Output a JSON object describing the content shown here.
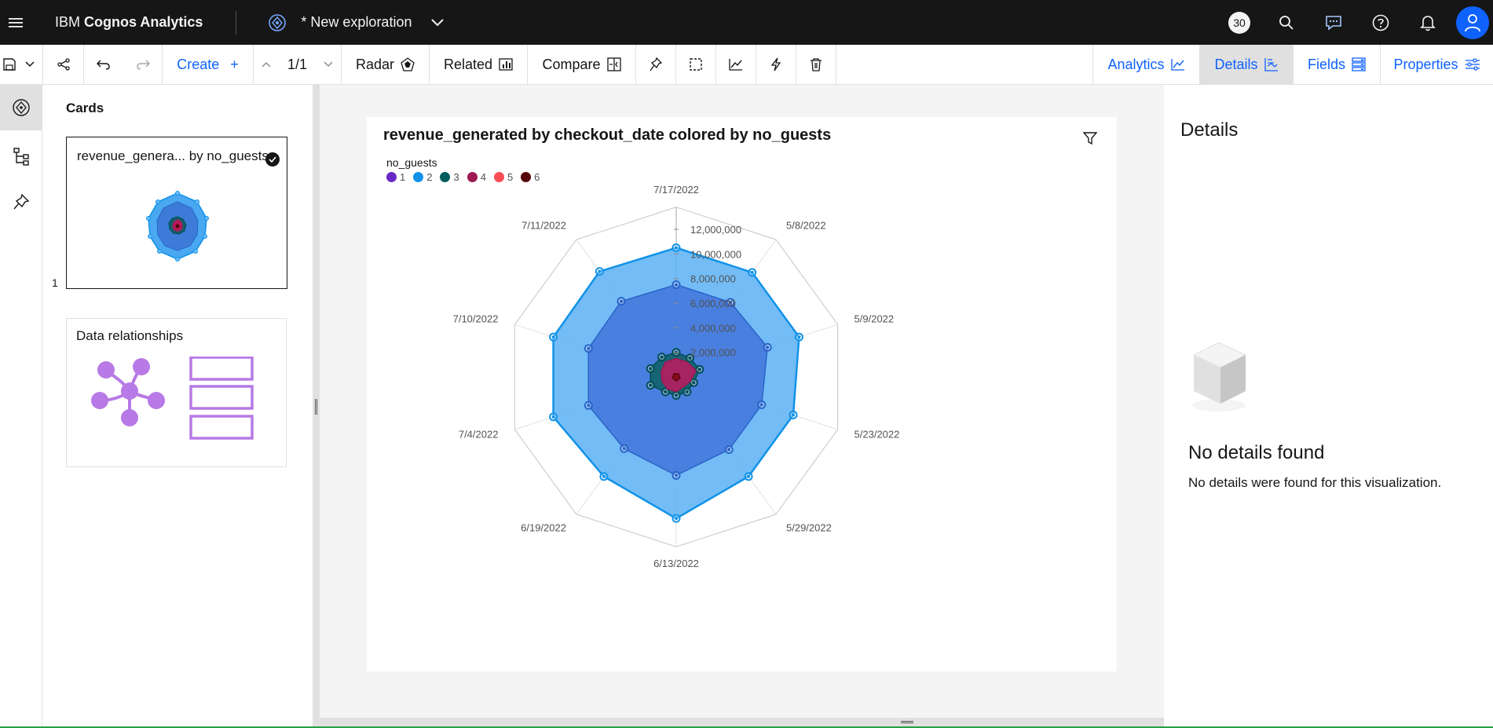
{
  "app": {
    "brand_prefix": "IBM",
    "brand_name": "Cognos Analytics",
    "exploration_title": "* New exploration",
    "notification_count": "30"
  },
  "toolbar": {
    "create_label": "Create",
    "create_plus": "+",
    "page_indicator": "1/1",
    "radar_label": "Radar",
    "related_label": "Related",
    "compare_label": "Compare",
    "right_tabs": [
      {
        "label": "Analytics",
        "active": false
      },
      {
        "label": "Details",
        "active": true
      },
      {
        "label": "Fields",
        "active": false
      },
      {
        "label": "Properties",
        "active": false
      }
    ]
  },
  "cards_panel": {
    "title": "Cards",
    "card1_label": "revenue_genera... by no_guests",
    "card1_number": "1",
    "card2_label": "Data relationships"
  },
  "chart_data": {
    "type": "radar",
    "title": "revenue_generated by checkout_date colored by no_guests",
    "legend_title": "no_guests",
    "axes": [
      "7/17/2022",
      "5/8/2022",
      "5/9/2022",
      "5/23/2022",
      "5/29/2022",
      "6/13/2022",
      "6/19/2022",
      "7/4/2022",
      "7/10/2022",
      "7/11/2022"
    ],
    "radial_ticks": [
      "2,000,000",
      "4,000,000",
      "6,000,000",
      "8,000,000",
      "10,000,000",
      "12,000,000"
    ],
    "rmax": 12000000,
    "series": [
      {
        "name": "1",
        "color": "#6929c4",
        "values": [
          0,
          0,
          0,
          0,
          0,
          0,
          0,
          0,
          0,
          0
        ]
      },
      {
        "name": "2",
        "color": "#1192e8",
        "values": [
          10500000,
          10500000,
          10500000,
          10000000,
          10000000,
          11500000,
          10000000,
          10500000,
          10500000,
          10600000
        ]
      },
      {
        "name": "3",
        "color": "#005d5d",
        "values": [
          2000000,
          1900000,
          2000000,
          1500000,
          1500000,
          1500000,
          1500000,
          2200000,
          2200000,
          2000000
        ]
      },
      {
        "name": "4",
        "color": "#9f1853",
        "values": [
          1500000,
          1500000,
          1700000,
          1200000,
          1000000,
          1200000,
          1200000,
          1200000,
          1300000,
          1500000
        ]
      },
      {
        "name": "5",
        "color": "#fa4d56",
        "values": [
          0,
          0,
          0,
          0,
          0,
          0,
          0,
          0,
          0,
          0
        ]
      },
      {
        "name": "6",
        "color": "#570408",
        "values": [
          0,
          0,
          0,
          0,
          0,
          0,
          0,
          0,
          0,
          0
        ]
      }
    ],
    "inner_series": {
      "name": "2 (inner)",
      "color": "#4589ff",
      "values": [
        7500000,
        7500000,
        7800000,
        7300000,
        7300000,
        8000000,
        7200000,
        7500000,
        7500000,
        7600000
      ]
    }
  },
  "details_panel": {
    "title": "Details",
    "empty_title": "No details found",
    "empty_text": "No details were found for this visualization."
  }
}
